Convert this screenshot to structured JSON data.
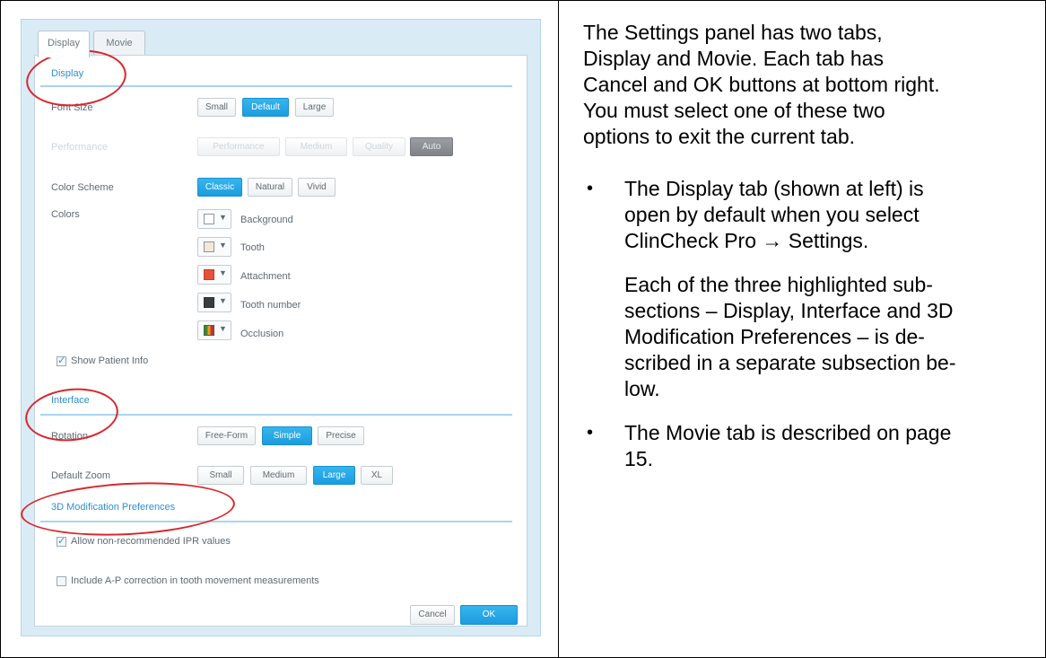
{
  "settings_panel": {
    "tabs": [
      "Display",
      "Movie"
    ],
    "display_section": {
      "title": "Display",
      "font_size": {
        "label": "Font Size",
        "options": [
          "Small",
          "Default",
          "Large"
        ],
        "selected": "Default"
      },
      "performance": {
        "label": "Performance",
        "options": [
          "Performance",
          "Medium",
          "Quality",
          "Auto"
        ],
        "selected": "Auto"
      },
      "color_scheme": {
        "label": "Color Scheme",
        "options": [
          "Classic",
          "Natural",
          "Vivid"
        ],
        "selected": "Classic"
      },
      "colors": {
        "label": "Colors",
        "items": [
          {
            "name": "Background",
            "color": "#ffffff"
          },
          {
            "name": "Tooth",
            "color": "#f6e7d8"
          },
          {
            "name": "Attachment",
            "color": "#e8503a"
          },
          {
            "name": "Tooth number",
            "color": "#3a3d40"
          },
          {
            "name": "Occlusion",
            "color": "#5a9a3a"
          }
        ]
      },
      "show_patient_info": {
        "label": "Show Patient Info",
        "checked": true
      }
    },
    "interface_section": {
      "title": "Interface",
      "rotation": {
        "label": "Rotation",
        "options": [
          "Free-Form",
          "Simple",
          "Precise"
        ],
        "selected": "Simple"
      },
      "default_zoom": {
        "label": "Default Zoom",
        "options": [
          "Small",
          "Medium",
          "Large",
          "XL"
        ],
        "selected": "Large"
      }
    },
    "modification_section": {
      "title": "3D Modification Preferences",
      "allow_ipr": {
        "label": "Allow non-recommended IPR values",
        "checked": true
      },
      "include_ap": {
        "label": "Include A-P correction in tooth movement measurements",
        "checked": false
      }
    },
    "footer": {
      "cancel": "Cancel",
      "ok": "OK"
    }
  },
  "description": {
    "intro_lines": [
      "The Settings panel has two tabs,",
      "Display and Movie. Each tab has",
      "Cancel and OK buttons at bottom right.",
      "You must select one of these two",
      "options to exit the current tab."
    ],
    "bullet1_lines": [
      "The Display tab (shown at left) is",
      "open by default when you select",
      "ClinCheck Pro →  Settings."
    ],
    "bullet1_para_lines": [
      "Each of the three highlighted sub-",
      "sections – Display, Interface and 3D",
      "Modification Preferences – is de-",
      "scribed in a separate subsection be-",
      "low."
    ],
    "bullet2_lines": [
      "The Movie tab is described on page",
      "15."
    ]
  },
  "accent_colors": {
    "selected_blue": "#1b9ce0",
    "highlight_red": "#d9262c"
  }
}
